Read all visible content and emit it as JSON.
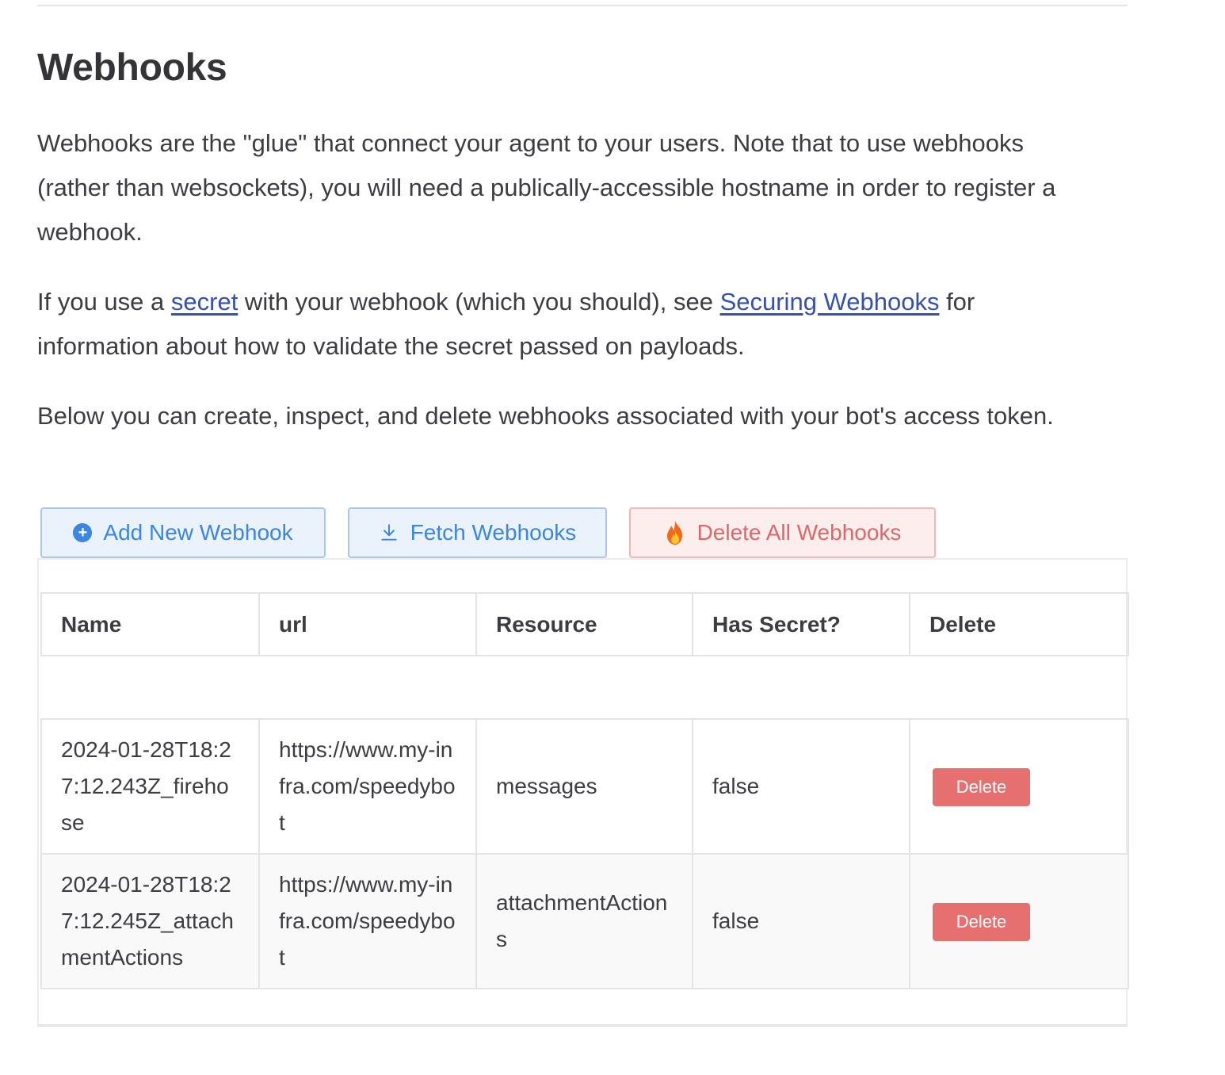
{
  "section": {
    "title": "Webhooks",
    "intro": "Webhooks are the \"glue\" that connect your agent to your users. Note that to use webhooks (rather than websockets), you will need a publically-accessible hostname in order to register a webhook.",
    "secret_para": {
      "before": "If you use a ",
      "secret_link": "secret",
      "middle": " with your webhook (which you should), see ",
      "securing_link": "Securing Webhooks",
      "after": " for information about how to validate the secret passed on payloads."
    },
    "manage_para": "Below you can create, inspect, and delete webhooks associated with your bot's access token."
  },
  "actions": {
    "add_label": "Add New Webhook",
    "add_icon": "plus-circle-icon",
    "fetch_label": "Fetch Webhooks",
    "fetch_icon": "download-icon",
    "delete_all_label": "Delete All Webhooks",
    "delete_all_icon": "fire-icon"
  },
  "table": {
    "headers": [
      "Name",
      "url",
      "Resource",
      "Has Secret?",
      "Delete"
    ],
    "rows": [
      {
        "name": "2024-01-28T18:27:12.243Z_firehose",
        "url": "https://www.my-infra.com/speedybot",
        "resource": "messages",
        "has_secret": "false",
        "delete_label": "Delete"
      },
      {
        "name": "2024-01-28T18:27:12.245Z_attachmentActions",
        "url": "https://www.my-infra.com/speedybot",
        "resource": "attachmentActions",
        "has_secret": "false",
        "delete_label": "Delete"
      }
    ]
  },
  "colors": {
    "link": "#3451b2",
    "primary": "#3a86e0",
    "danger": "#e5706f"
  }
}
